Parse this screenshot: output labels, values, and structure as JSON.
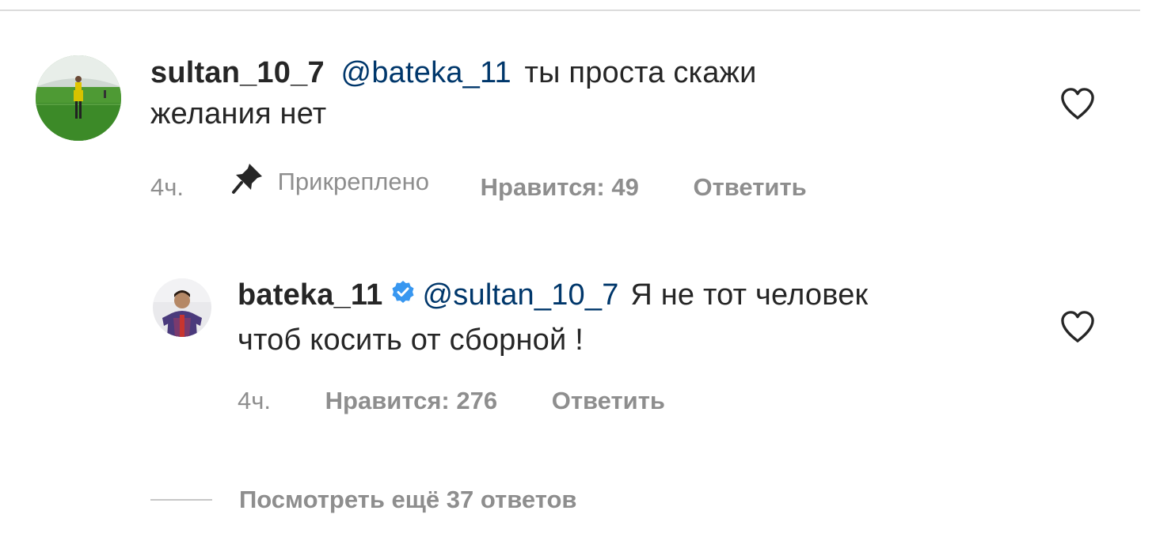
{
  "comments": [
    {
      "username": "sultan_10_7",
      "mention": "@bateka_11",
      "text_line1": " ты проста скажи",
      "text_line2": "желания нет",
      "time": "4ч.",
      "pinned_label": "Прикреплено",
      "likes": "Нравится: 49",
      "reply": "Ответить",
      "verified": false
    },
    {
      "username": "bateka_11",
      "mention": "@sultan_10_7",
      "text_line1": " Я не тот человек",
      "text_line2": "чтоб косить от сборной !",
      "time": "4ч.",
      "likes": "Нравится: 276",
      "reply": "Ответить",
      "verified": true
    }
  ],
  "view_more_replies": "Посмотреть ещё 37 ответов",
  "icons": {
    "like": "heart-outline-icon",
    "pin": "pin-icon",
    "verified": "verified-badge-icon"
  },
  "colors": {
    "text": "#262626",
    "secondary": "#8e8e8e",
    "mention": "#00376b",
    "verified": "#3897f0"
  }
}
